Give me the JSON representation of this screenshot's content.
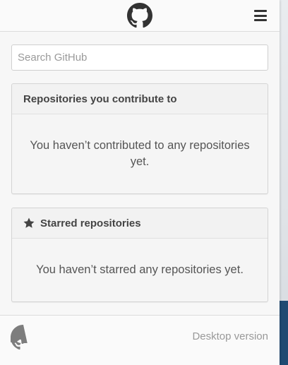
{
  "header": {
    "logo_icon": "github-octocat-icon",
    "menu_icon": "hamburger-menu-icon"
  },
  "search": {
    "placeholder": "Search GitHub",
    "value": ""
  },
  "panels": [
    {
      "title": "Repositories you contribute to",
      "message": "You haven’t contributed to any repositories yet.",
      "icon": null
    },
    {
      "title": "Starred repositories",
      "message": "You haven’t starred any repositories yet.",
      "icon": "star-icon"
    }
  ],
  "footer": {
    "logo_icon": "github-octocat-icon",
    "desktop_link": "Desktop version"
  },
  "colors": {
    "drawer_background": "#f7f7f7",
    "panel_background": "#f5f5f5",
    "text_dark": "#444444",
    "text_muted": "#999999",
    "backdrop_accent": "#1f4a72"
  }
}
